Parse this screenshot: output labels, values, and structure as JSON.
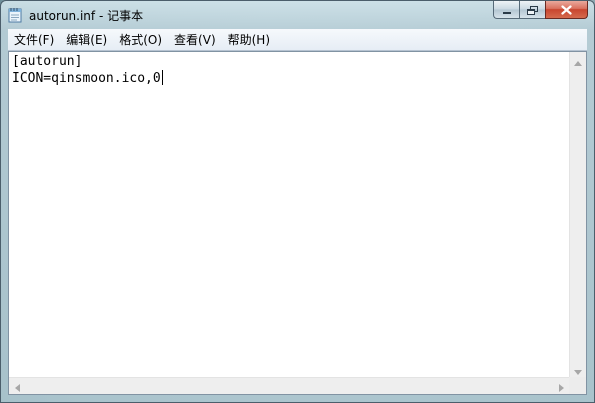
{
  "window": {
    "title": "autorun.inf - 记事本",
    "icon": "notepad-icon"
  },
  "caption_buttons": {
    "minimize_icon": "minimize-icon",
    "maximize_icon": "restore-icon",
    "close_icon": "close-icon"
  },
  "menu": {
    "items": [
      {
        "label": "文件(F)"
      },
      {
        "label": "编辑(E)"
      },
      {
        "label": "格式(O)"
      },
      {
        "label": "查看(V)"
      },
      {
        "label": "帮助(H)"
      }
    ]
  },
  "document": {
    "lines": [
      "[autorun]",
      "ICON=qinsmoon.ico,0"
    ]
  },
  "colors": {
    "close_button": "#c8452e",
    "editor_background": "#ffffff"
  }
}
